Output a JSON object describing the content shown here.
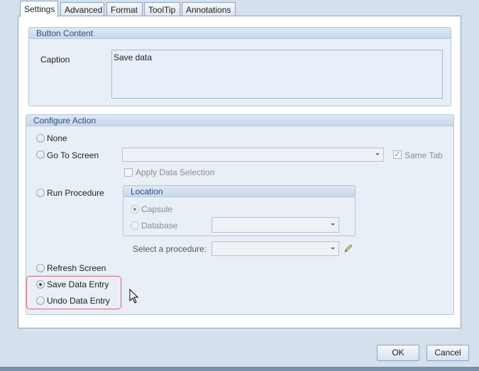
{
  "tabs": [
    {
      "label": "Settings",
      "active": true
    },
    {
      "label": "Advanced",
      "active": false
    },
    {
      "label": "Format",
      "active": false
    },
    {
      "label": "ToolTip",
      "active": false
    },
    {
      "label": "Annotations",
      "active": false
    }
  ],
  "button_content": {
    "title": "Button Content",
    "caption_label": "Caption",
    "caption_value": "Save data"
  },
  "configure_action": {
    "title": "Configure Action",
    "options": {
      "none": "None",
      "go_to_screen": "Go To Screen",
      "run_procedure": "Run Procedure",
      "refresh_screen": "Refresh Screen",
      "save_data_entry": "Save Data Entry",
      "undo_data_entry": "Undo Data Entry"
    },
    "selected": "Save Data Entry",
    "same_tab_label": "Same Tab",
    "same_tab_checked": true,
    "apply_data_selection_label": "Apply Data Selection",
    "apply_data_selection_checked": false,
    "location": {
      "title": "Location",
      "capsule_label": "Capsule",
      "database_label": "Database",
      "selected": "Capsule"
    },
    "select_procedure_label": "Select a procedure:"
  },
  "footer": {
    "ok_label": "OK",
    "cancel_label": "Cancel"
  },
  "icons": {
    "dropdown": "chevron-down-icon",
    "edit": "pencil-icon",
    "cursor": "mouse-pointer-icon"
  },
  "colors": {
    "highlight": "#d6757e",
    "group_title": "#2b4e80"
  }
}
